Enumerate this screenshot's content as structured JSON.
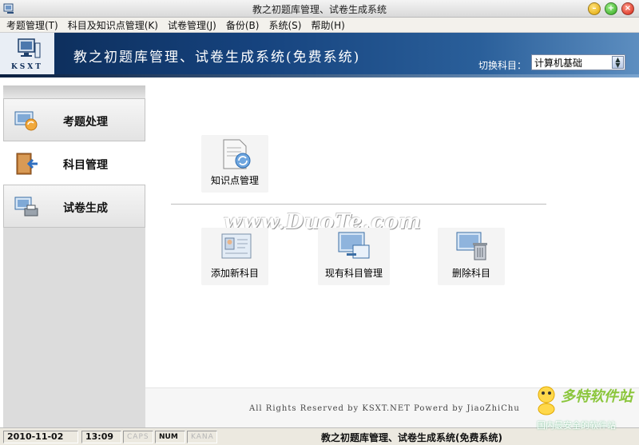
{
  "window": {
    "title": "教之初题库管理、试卷生成系统"
  },
  "menu": {
    "items": [
      {
        "label": "考题管理(T)"
      },
      {
        "label": "科目及知识点管理(K)"
      },
      {
        "label": "试卷管理(J)"
      },
      {
        "label": "备份(B)"
      },
      {
        "label": "系统(S)"
      },
      {
        "label": "帮助(H)"
      }
    ]
  },
  "banner": {
    "logo_text": "KSXT",
    "title": "教之初题库管理、试卷生成系统(免费系统)",
    "subject_label": "切换科目：",
    "subject_value": "计算机基础"
  },
  "sidebar": {
    "items": [
      {
        "label": "考题处理",
        "icon": "question-processing-icon",
        "state": "inactive"
      },
      {
        "label": "科目管理",
        "icon": "subject-management-icon",
        "state": "active"
      },
      {
        "label": "试卷生成",
        "icon": "exam-generation-icon",
        "state": "inactive"
      }
    ]
  },
  "content": {
    "tiles": [
      {
        "label": "知识点管理",
        "icon": "knowledge-point-icon"
      },
      {
        "label": "添加新科目",
        "icon": "add-subject-icon"
      },
      {
        "label": "现有科目管理",
        "icon": "existing-subjects-icon"
      },
      {
        "label": "删除科目",
        "icon": "delete-subject-icon"
      }
    ],
    "watermark": "www.DuoTe.com",
    "copyright": "All Rights Reserved by KSXT.NET Powerd by JiaoZhiChu"
  },
  "status": {
    "date": "2010-11-02",
    "time": "13:09",
    "caps": "CAPS",
    "num": "NUM",
    "kana": "KANA",
    "app_name": "教之初题库管理、试卷生成系统(免费系统)"
  },
  "corner_badge": {
    "title": "多特软件站",
    "subtitle": "国内最安全的软件站"
  },
  "colors": {
    "banner_dark": "#0b2a55",
    "banner_light": "#5d8ec0",
    "sidebar_bg": "#dcdcdc",
    "badge_green": "#8bc63c"
  }
}
